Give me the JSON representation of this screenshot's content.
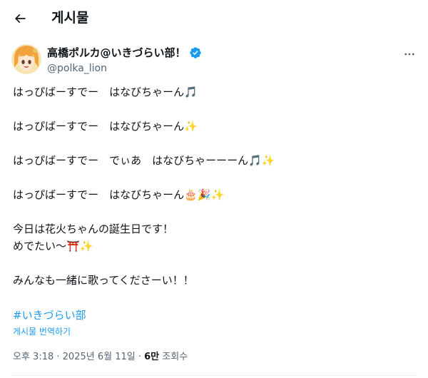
{
  "header": {
    "back_icon": "arrow-left-icon",
    "title": "게시물"
  },
  "author": {
    "display_name": "高橋ポルカ@いきづらい部！",
    "handle": "@polka_lion",
    "verified": true,
    "verified_color": "#1d9bf0"
  },
  "tweet": {
    "paragraphs": [
      {
        "lines": [
          "はっぴばーすでー　はなびちゃーん🎵"
        ]
      },
      {
        "lines": [
          "はっぴばーすでー　はなびちゃーん✨"
        ]
      },
      {
        "lines": [
          "はっぴばーすでー　でぃあ　はなびちゃーーーん🎵✨"
        ]
      },
      {
        "lines": [
          "はっぴばーすでー　はなびちゃーん🎂🎉✨"
        ]
      },
      {
        "lines": [
          "今日は花火ちゃんの誕生日です！",
          "めでたい〜⛩️✨"
        ]
      },
      {
        "lines": [
          "みんなも一緒に歌ってくださーい！！"
        ]
      }
    ],
    "hashtag": "#いきづらい部",
    "translate_label": "게시물 번역하기"
  },
  "meta": {
    "time": "오후 3:18",
    "separator": " · ",
    "date": "2025년 6월 11일",
    "views_count": "6만",
    "views_label": " 조회수"
  },
  "colors": {
    "link": "#1d9bf0",
    "secondary_text": "#536471",
    "primary_text": "#0f1419"
  }
}
